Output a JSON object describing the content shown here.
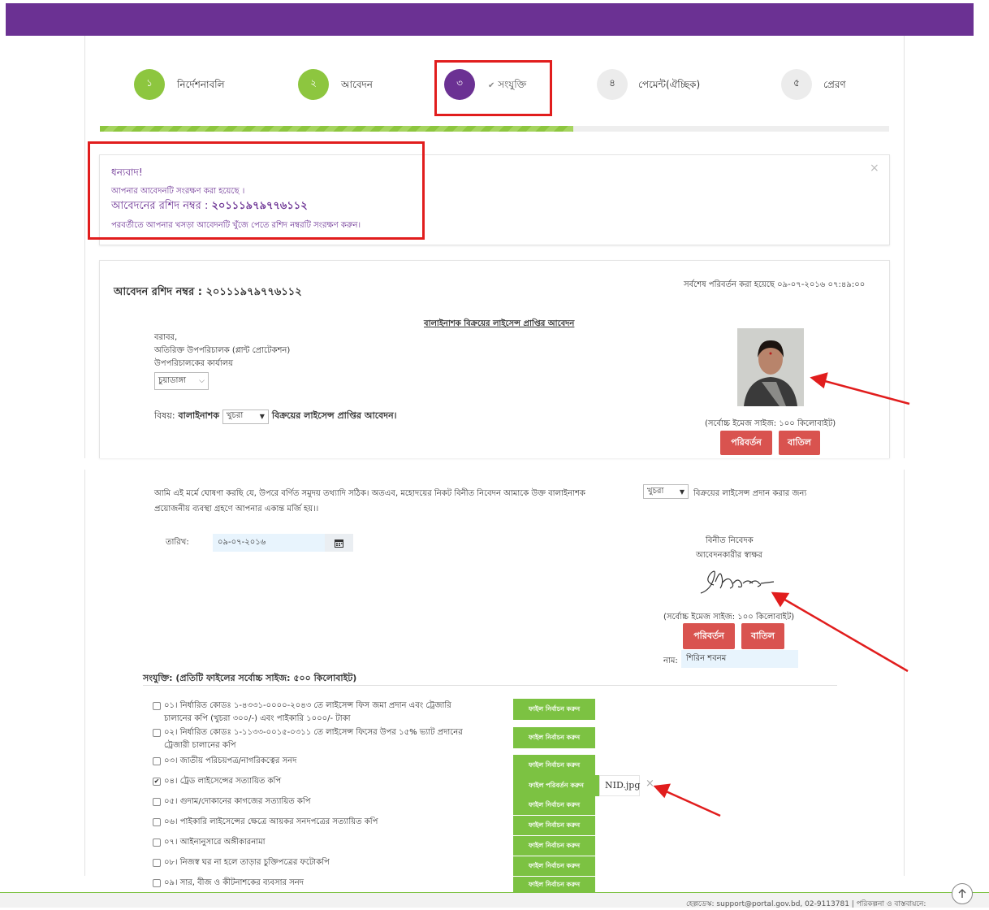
{
  "steps": [
    {
      "num": "১",
      "label": "নির্দেশনাবলি"
    },
    {
      "num": "২",
      "label": "আবেদন"
    },
    {
      "num": "৩",
      "check": "✔",
      "label": "সংযুক্তি"
    },
    {
      "num": "৪",
      "label": "পেমেন্ট(ঐচ্ছিক)"
    },
    {
      "num": "৫",
      "label": "প্রেরণ"
    }
  ],
  "progress_fraction": 0.6,
  "alert": {
    "title": "ধন্যবাদ!",
    "saved": "আপনার আবেদনটি সংরক্ষণ করা হয়েছে ।",
    "receipt_label": "আবেদনের রশিদ নম্বর :",
    "receipt_no": "২০১১১৯৭৯৭৭৬১১২",
    "note": "পরবর্তীতে আপনার খসড়া আবেদনটি খুঁজে পেতে রশিদ নম্বরটি সংরক্ষণ করুন।",
    "close": "×"
  },
  "form": {
    "receipt_heading": "আবেদন রশিদ নম্বর : ২০১১১৯৭৯৭৭৬১১২",
    "last_modified": "সর্বশেষ পরিবর্তন করা হয়েছে ০৯-০৭-২০১৬ ০৭:৪৯:০০",
    "title": "বালাইনাশক বিক্রয়ের লাইসেন্স প্রাপ্তির আবেদন",
    "to": "বরাবর,",
    "addressee": "অতিরিক্ত উপপরিচালক (প্লান্ট প্রোটেকশন)",
    "office": "উপপরিচালকের কার্যালয়",
    "district": "চুয়াডাঙ্গা",
    "subject_prefix": "বিষয়:",
    "subject_bold1": "বালাইনাশক",
    "subject_select": "খুচরা",
    "subject_bold2": "বিক্রয়ের লাইসেন্স প্রাপ্তির আবেদন।",
    "photo_size_note": "(সর্বোচ্চ ইমেজ সাইজ: ১০০ কিলোবাইট)",
    "change_btn": "পরিবর্তন",
    "cancel_btn": "বাতিল",
    "declaration_1": "আমি এই মর্মে ঘোষণা করছি যে, উপরে বর্ণিত সমুদয় তথ্যাদি সঠিক। অতএব, মহোদয়ের নিকট বিনীত নিবেদন আমাকে উক্ত বালাইনাশক",
    "declaration_select": "খুচরা",
    "declaration_2": "বিক্রয়ের লাইসেন্স প্রদান করার জন্য",
    "declaration_3": "প্রয়োজনীয় ব্যবস্থা গ্রহণে আপনার একান্ত মর্জি হয়।।",
    "date_label": "তারিখ:",
    "date_value": "০৯-০৭-২০১৬",
    "humbly": "বিনীত নিবেদক",
    "signature_label": "আবেদনকারীর স্বাক্ষর",
    "signature_size_note": "(সর্বোচ্চ ইমেজ সাইজ: ১০০ কিলোবাইট)",
    "name_label": "নাম:",
    "name_value": "শিরিন শবনম"
  },
  "attachments": {
    "heading": "সংযুক্তি: (প্রতিটি ফাইলের সর্বোচ্চ সাইজ: ৫০০ কিলোবাইট)",
    "select_label": "ফাইল নির্বাচন করুন",
    "change_label": "ফাইল পরিবর্তন করুন",
    "items": [
      {
        "text": "০১। নির্ধারিত কোডঃ ১-৪৩৩১-০০০০-২০৪৩ তে লাইসেন্স ফিস জমা প্রদান এবং ট্রেজারি",
        "text2": "চালানের কপি (খুচরা ৩০০/-) এবং পাইকারি ১০০০/- টাকা",
        "checked": false
      },
      {
        "text": "০২। নির্ধারিত কোডঃ ১-১১৩৩-০০১৫-০৩১১ তে লাইসেন্স ফিসের উপর ১৫% ভ্যাট প্রদানের",
        "text2": "ট্রেজারী চালানের কপি",
        "checked": false
      },
      {
        "text": "০৩। জাতীয় পরিচয়পত্র/নাগরিকত্বের সনদ",
        "checked": false
      },
      {
        "text": "০৪। ট্রেড লাইসেন্সের সত্যায়িত কপি",
        "checked": true,
        "file": "NID.jpg",
        "remove": "×"
      },
      {
        "text": "০৫। গুদাম/দোকানের কাগজের সত্যায়িত কপি",
        "checked": false
      },
      {
        "text": "০৬। পাইকারি লাইসেন্সের ক্ষেত্রে আয়কর সনদপত্রের সত্যায়িত কপি",
        "checked": false
      },
      {
        "text": "০৭। আইনানুসারে অঙ্গীকারনামা",
        "checked": false
      },
      {
        "text": "০৮। নিজস্ব ঘর না হলে তাড়ার চুক্তিপত্রের ফটোকপি",
        "checked": false
      },
      {
        "text": "০৯। সার, বীজ ও কীটনাশকের ব্যবসার সনদ",
        "checked": false
      }
    ]
  },
  "footer": {
    "text": "হেল্পডেস্ক: support@portal.gov.bd, 02-9113781 | পরিকল্পনা ও বাস্তবায়নে:"
  },
  "icons": {
    "check": "check-icon",
    "calendar": "calendar-icon",
    "close": "close-icon",
    "scroll_up": "scroll-up-icon"
  },
  "colors": {
    "brand_purple": "#6b3193",
    "step_green": "#8dc63f",
    "danger_red": "#d9534f",
    "file_green": "#7cc242",
    "annotation_red": "#e11d1d"
  }
}
